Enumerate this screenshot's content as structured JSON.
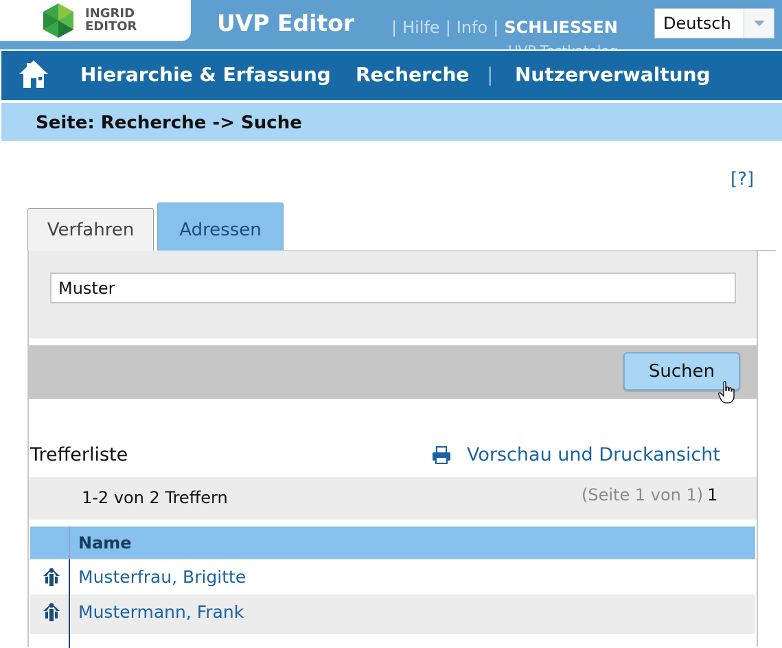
{
  "header": {
    "logo_line1": "INGRID",
    "logo_line2": "EDITOR",
    "app_title": "UVP Editor",
    "links": [
      "Hilfe",
      "Info"
    ],
    "close_label": "SCHLIESSEN",
    "language_value": "Deutsch",
    "clipped_text": "UVP Testkatalog"
  },
  "nav": {
    "items": [
      "Hierarchie & Erfassung",
      "Recherche",
      "Nutzerverwaltung"
    ],
    "separator": "|"
  },
  "breadcrumb": "Seite: Recherche -> Suche",
  "help_link": "[?]",
  "tabs": [
    "Verfahren",
    "Adressen"
  ],
  "search": {
    "value": "Muster",
    "button_label": "Suchen"
  },
  "results": {
    "title": "Trefferliste",
    "print_label": "Vorschau und Druckansicht",
    "count_text": "1-2 von 2 Treffern",
    "page_info": "(Seite 1 von 1)",
    "page_number": "1",
    "column_name": "Name",
    "rows": [
      "Musterfrau, Brigitte",
      "Mustermann, Frank"
    ]
  },
  "colors": {
    "header_bg": "#5f9fd0",
    "nav_bg": "#176aa6",
    "breadcrumb_bg": "#a9d6f5",
    "accent_tab": "#86c0ec",
    "link": "#1a63a3"
  }
}
